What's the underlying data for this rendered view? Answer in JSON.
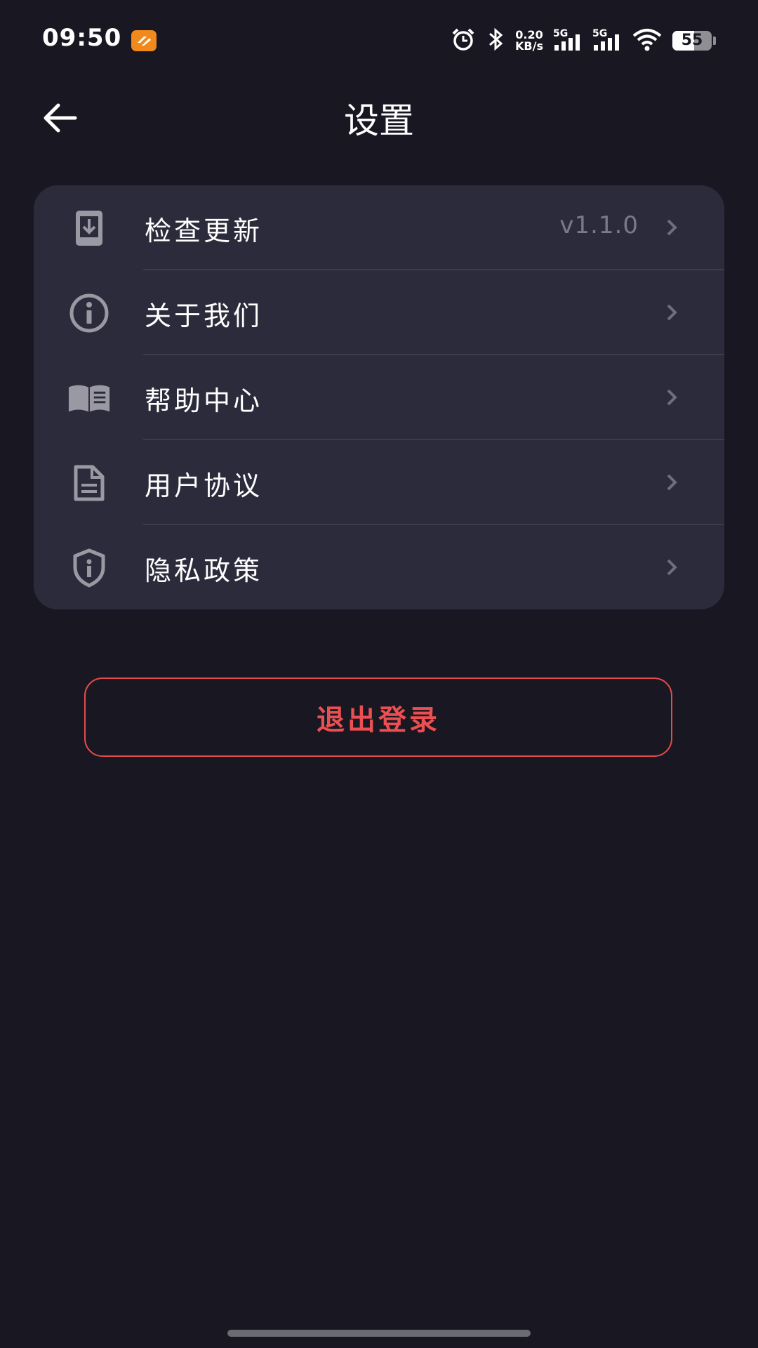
{
  "status_bar": {
    "time": "09:50",
    "net_speed_value": "0.20",
    "net_speed_unit": "KB/s",
    "signal_1_label": "5G",
    "signal_2_label": "5G",
    "battery_level": "55",
    "battery_fraction": 0.55,
    "app_icon": "orange-app-icon"
  },
  "header": {
    "title": "设置",
    "back_icon": "arrow-left-icon"
  },
  "settings": {
    "items": [
      {
        "label": "检查更新",
        "value": "v1.1.0",
        "icon": "download-phone-icon"
      },
      {
        "label": "关于我们",
        "value": "",
        "icon": "info-circle-icon"
      },
      {
        "label": "帮助中心",
        "value": "",
        "icon": "open-book-icon"
      },
      {
        "label": "用户协议",
        "value": "",
        "icon": "document-icon"
      },
      {
        "label": "隐私政策",
        "value": "",
        "icon": "shield-info-icon"
      }
    ]
  },
  "logout": {
    "label": "退出登录",
    "color": "#ec4f52"
  },
  "colors": {
    "background": "#191822",
    "card": "#2c2b3b",
    "icon_gray": "#9a99a3",
    "chevron_gray": "#6f6e7a"
  }
}
